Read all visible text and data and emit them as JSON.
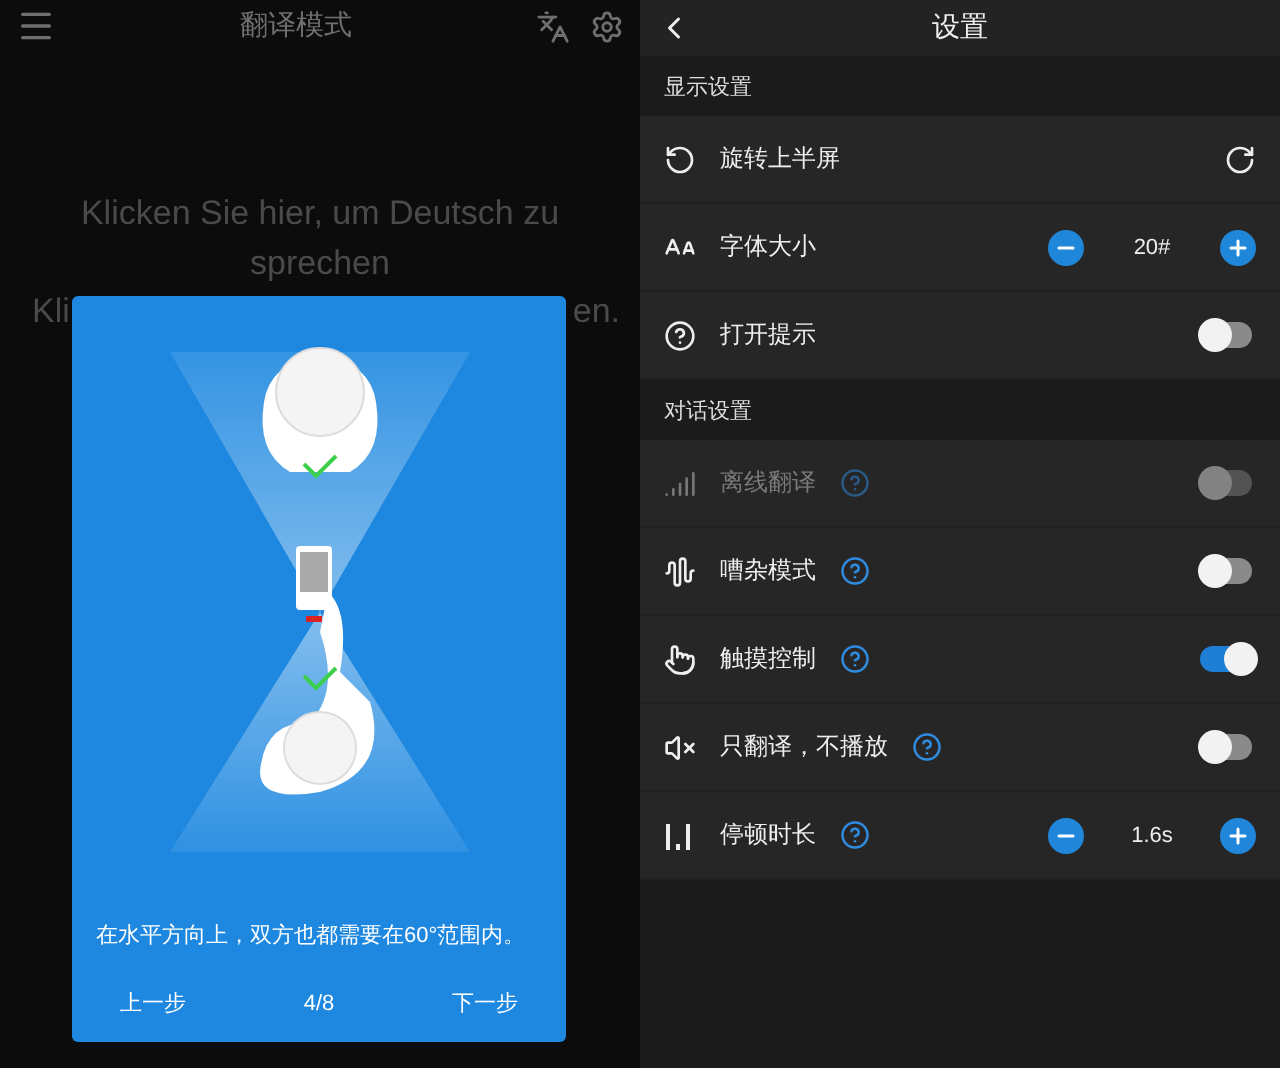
{
  "translate_screen": {
    "title": "翻译模式",
    "prompt_line_1": "Klicken Sie hier, um Deutsch zu sprechen",
    "prompt_line_2_start": "Kli",
    "prompt_line_2_end": "en.",
    "dialog": {
      "message": "在水平方向上，双方也都需要在60°范围内。",
      "back": "上一步",
      "page": "4/8",
      "next": "下一步"
    }
  },
  "settings": {
    "title": "设置",
    "sections": [
      {
        "title": "显示设置",
        "rows": [
          {
            "kind": "rotate",
            "label": "旋转上半屏",
            "help": false
          },
          {
            "kind": "stepper",
            "label": "字体大小",
            "help": false,
            "value": "20#"
          },
          {
            "kind": "toggle",
            "label": "打开提示",
            "help": false,
            "on": false,
            "disabled": false
          }
        ]
      },
      {
        "title": "对话设置",
        "rows": [
          {
            "kind": "toggle",
            "label": "离线翻译",
            "help": true,
            "on": false,
            "disabled": true
          },
          {
            "kind": "toggle",
            "label": "嘈杂模式",
            "help": true,
            "on": false,
            "disabled": false
          },
          {
            "kind": "toggle",
            "label": "触摸控制",
            "help": true,
            "on": true,
            "disabled": false
          },
          {
            "kind": "toggle",
            "label": "只翻译，不播放",
            "help": true,
            "on": false,
            "disabled": false
          },
          {
            "kind": "stepper",
            "label": "停顿时长",
            "help": true,
            "value": "1.6s"
          }
        ]
      }
    ]
  }
}
